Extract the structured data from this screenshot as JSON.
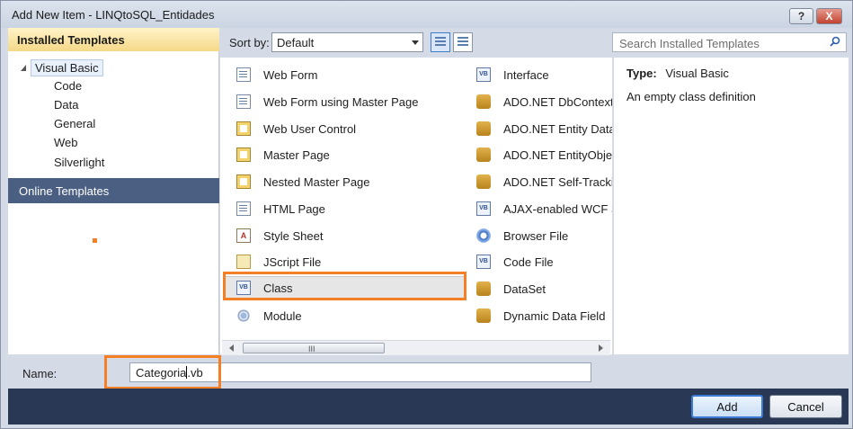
{
  "window": {
    "title": "Add New Item - LINQtoSQL_Entidades",
    "help_label": "?",
    "close_label": "X"
  },
  "left_panel": {
    "installed_header": "Installed Templates",
    "tree_root": "Visual Basic",
    "tree_children": [
      "Code",
      "Data",
      "General",
      "Web",
      "Silverlight"
    ],
    "online_templates": "Online Templates"
  },
  "toolbar": {
    "sort_label": "Sort by:",
    "sort_value": "Default",
    "search_placeholder": "Search Installed Templates"
  },
  "templates_col1": [
    {
      "label": "Web Form",
      "icon": "web-form-icon"
    },
    {
      "label": "Web Form using Master Page",
      "icon": "web-form-master-icon"
    },
    {
      "label": "Web User Control",
      "icon": "user-control-icon"
    },
    {
      "label": "Master Page",
      "icon": "master-page-icon"
    },
    {
      "label": "Nested Master Page",
      "icon": "nested-master-page-icon"
    },
    {
      "label": "HTML Page",
      "icon": "html-page-icon"
    },
    {
      "label": "Style Sheet",
      "icon": "style-sheet-icon"
    },
    {
      "label": "JScript File",
      "icon": "jscript-icon"
    },
    {
      "label": "Class",
      "icon": "vb-class-icon"
    },
    {
      "label": "Module",
      "icon": "module-icon"
    }
  ],
  "templates_col2": [
    {
      "label": "Interface",
      "icon": "interface-icon"
    },
    {
      "label": "ADO.NET DbContext",
      "icon": "dbcontext-icon"
    },
    {
      "label": "ADO.NET Entity Data",
      "icon": "entity-data-icon"
    },
    {
      "label": "ADO.NET EntityObjec",
      "icon": "entity-object-icon"
    },
    {
      "label": "ADO.NET Self-Trackin",
      "icon": "self-tracking-icon"
    },
    {
      "label": "AJAX-enabled WCF S",
      "icon": "wcf-service-icon"
    },
    {
      "label": "Browser File",
      "icon": "browser-file-icon"
    },
    {
      "label": "Code File",
      "icon": "code-file-icon"
    },
    {
      "label": "DataSet",
      "icon": "dataset-icon"
    },
    {
      "label": "Dynamic Data Field",
      "icon": "dynamic-data-field-icon"
    }
  ],
  "selected_template": "Class",
  "scrollbar": {
    "grip": "III"
  },
  "description": {
    "type_label": "Type:",
    "type_value": "Visual Basic",
    "text": "An empty class definition"
  },
  "name_row": {
    "label": "Name:",
    "value_before_caret": "Categoria",
    "value_after_caret": ".vb"
  },
  "buttons": {
    "add": "Add",
    "cancel": "Cancel"
  },
  "colors": {
    "highlight": "#f47f24",
    "footer": "#293955",
    "installed_header": "#f5d988",
    "online_selected": "#4a5f82"
  }
}
